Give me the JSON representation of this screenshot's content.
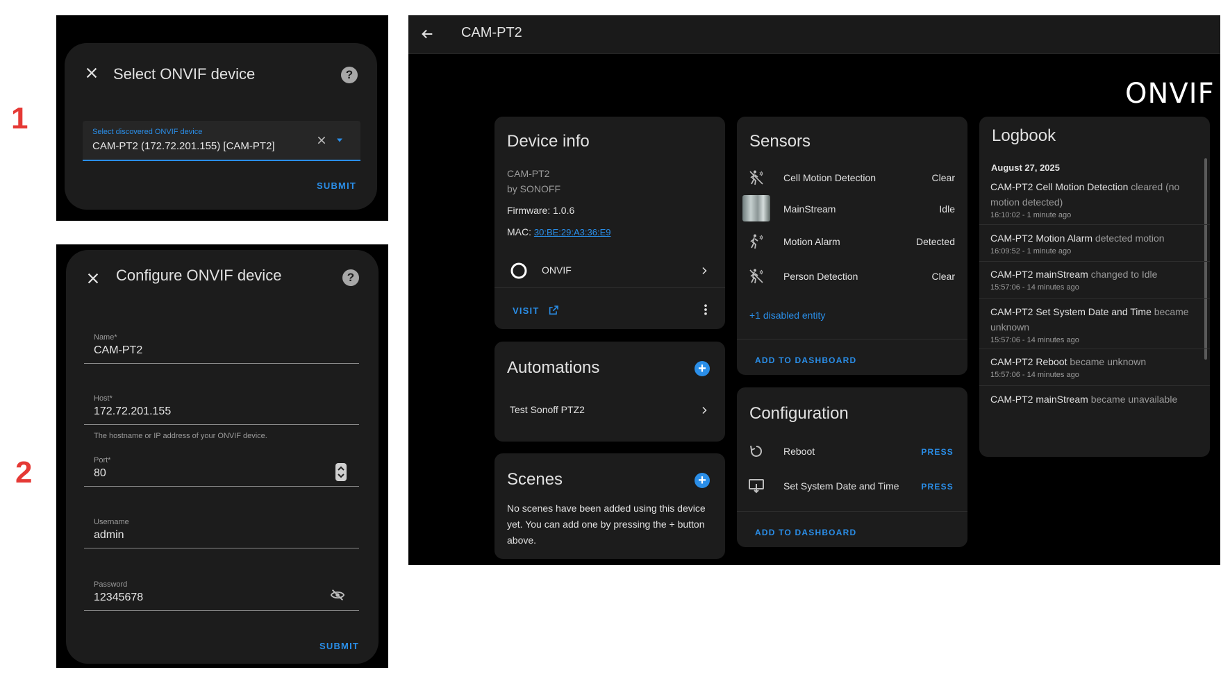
{
  "steps": [
    "1",
    "2"
  ],
  "dialog1": {
    "title": "Select ONVIF device",
    "field_label": "Select discovered ONVIF device",
    "field_value": "CAM-PT2 (172.72.201.155) [CAM-PT2]",
    "submit": "SUBMIT"
  },
  "dialog2": {
    "title": "Configure ONVIF device",
    "fields": [
      {
        "label": "Name*",
        "value": "CAM-PT2"
      },
      {
        "label": "Host*",
        "value": "172.72.201.155"
      },
      {
        "label": "Port*",
        "value": "80"
      },
      {
        "label": "Username",
        "value": "admin"
      },
      {
        "label": "Password",
        "value": "12345678"
      }
    ],
    "host_helper": "The hostname or IP address of your ONVIF device.",
    "submit": "SUBMIT"
  },
  "device_page": {
    "title": "CAM-PT2",
    "logo": "ONVIF",
    "device_info": {
      "title": "Device info",
      "model": "CAM-PT2",
      "manufacturer": "by SONOFF",
      "firmware": "Firmware: 1.0.6",
      "mac_label": "MAC: ",
      "mac": "30:BE:29:A3:36:E9",
      "integration": "ONVIF",
      "visit": "VISIT"
    },
    "automations": {
      "title": "Automations",
      "items": [
        "Test Sonoff PTZ2"
      ]
    },
    "scenes": {
      "title": "Scenes",
      "empty_text": "No scenes have been added using this device yet. You can add one by pressing the + button above."
    },
    "sensors": {
      "title": "Sensors",
      "items": [
        {
          "name": "Cell Motion Detection",
          "state": "Clear",
          "icon": "motion-sensor-off-icon"
        },
        {
          "name": "MainStream",
          "state": "Idle",
          "icon": "camera-thumbnail"
        },
        {
          "name": "Motion Alarm",
          "state": "Detected",
          "icon": "motion-sensor-icon"
        },
        {
          "name": "Person Detection",
          "state": "Clear",
          "icon": "motion-sensor-off-icon"
        }
      ],
      "disabled": "+1 disabled entity",
      "add": "ADD TO DASHBOARD"
    },
    "configuration": {
      "title": "Configuration",
      "items": [
        {
          "name": "Reboot",
          "action": "PRESS",
          "icon": "restart-icon"
        },
        {
          "name": "Set System Date and Time",
          "action": "PRESS",
          "icon": "monitor-arrow-icon"
        }
      ],
      "add": "ADD TO DASHBOARD"
    },
    "logbook": {
      "title": "Logbook",
      "date": "August 27, 2025",
      "entries": [
        {
          "entity": "CAM-PT2 Cell Motion Detection",
          "action": " cleared (no motion detected)",
          "time": "16:10:02 - 1 minute ago"
        },
        {
          "entity": "CAM-PT2 Motion Alarm",
          "action": " detected motion",
          "time": "16:09:52 - 1 minute ago"
        },
        {
          "entity": "CAM-PT2 mainStream",
          "action": " changed to Idle",
          "time": "15:57:06 - 14 minutes ago"
        },
        {
          "entity": "CAM-PT2 Set System Date and Time",
          "action": " became unknown",
          "time": "15:57:06 - 14 minutes ago"
        },
        {
          "entity": "CAM-PT2 Reboot",
          "action": " became unknown",
          "time": "15:57:06 - 14 minutes ago"
        },
        {
          "entity": "CAM-PT2 mainStream",
          "action": " became unavailable",
          "time": ""
        }
      ]
    }
  }
}
